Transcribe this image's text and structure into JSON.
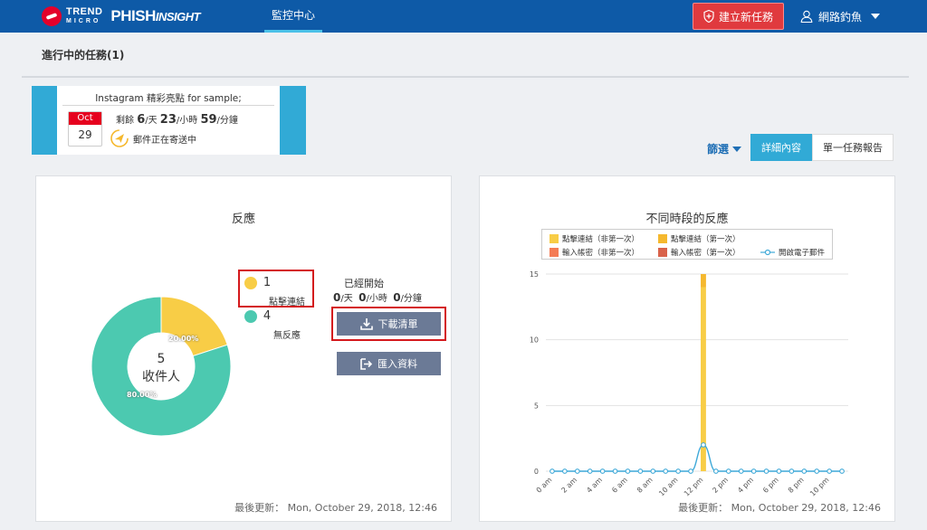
{
  "header": {
    "logo_trend": "TREND",
    "logo_micro": "MICRO",
    "logo_phish": "PHISH",
    "logo_insight": "INSIGHT",
    "nav_tab": "監控中心",
    "new_task_label": "建立新任務",
    "user_name": "網路釣魚",
    "colors": {
      "bar": "#0e5aa7",
      "accent": "#e03a3e"
    }
  },
  "section": {
    "title": "進行中的任務(1)"
  },
  "task": {
    "name": "Instagram 精彩亮點 for sample;",
    "month": "Oct",
    "day": "29",
    "remain_prefix": "剩餘",
    "days": "6",
    "days_unit": "/天",
    "hours": "23",
    "hours_unit": "/小時",
    "minutes": "59",
    "minutes_unit": "/分鐘",
    "status": "郵件正在寄送中"
  },
  "toolbar": {
    "filter_label": "篩選",
    "details_label": "詳細內容",
    "report_label": "單一任務報告"
  },
  "reaction_panel": {
    "title": "反應",
    "center_count": "5",
    "center_label": "收件人",
    "click_count": "1",
    "click_label": "點擊連結",
    "click_color": "#f8cd46",
    "no_response_count": "4",
    "no_response_label": "無反應",
    "no_response_color": "#4cc9b0",
    "click_pct": "20.00%",
    "no_response_pct": "80.00%",
    "started_label": "已經開始",
    "elapsed_days": "0",
    "elapsed_days_unit": "/天",
    "elapsed_hours": "0",
    "elapsed_hours_unit": "/小時",
    "elapsed_minutes": "0",
    "elapsed_minutes_unit": "/分鐘",
    "download_label": "下載清單",
    "import_label": "匯入資料",
    "updated": "最後更新： Mon, October 29, 2018, 12:46"
  },
  "time_panel": {
    "title": "不同時段的反應",
    "updated": "最後更新： Mon, October 29, 2018, 12:46"
  },
  "chart_data": {
    "type": "bar",
    "title": "不同時段的反應",
    "xlabel": "",
    "ylabel": "",
    "ylim": [
      0,
      15
    ],
    "yticks": [
      0,
      5,
      10,
      15
    ],
    "categories": [
      "0 am",
      "1 am",
      "2 am",
      "3 am",
      "4 am",
      "5 am",
      "6 am",
      "7 am",
      "8 am",
      "9 am",
      "10 am",
      "11 am",
      "12 pm",
      "1 pm",
      "2 pm",
      "3 pm",
      "4 pm",
      "5 pm",
      "6 pm",
      "7 pm",
      "8 pm",
      "9 pm",
      "10 pm",
      "11 pm"
    ],
    "xtick_labels": [
      "0 am",
      "2 am",
      "4 am",
      "6 am",
      "8 am",
      "10 am",
      "12 pm",
      "2 pm",
      "4 pm",
      "6 pm",
      "8 pm",
      "10 pm"
    ],
    "legend": "top",
    "grid": true,
    "series": [
      {
        "name": "點擊連結（非第一次）",
        "type": "bar",
        "color": "#f8cd46",
        "values": [
          0,
          0,
          0,
          0,
          0,
          0,
          0,
          0,
          0,
          0,
          0,
          0,
          14,
          0,
          0,
          0,
          0,
          0,
          0,
          0,
          0,
          0,
          0,
          0
        ]
      },
      {
        "name": "點擊連結（第一次）",
        "type": "bar",
        "color": "#f5b82e",
        "values": [
          0,
          0,
          0,
          0,
          0,
          0,
          0,
          0,
          0,
          0,
          0,
          0,
          1,
          0,
          0,
          0,
          0,
          0,
          0,
          0,
          0,
          0,
          0,
          0
        ]
      },
      {
        "name": "輸入帳密（非第一次）",
        "type": "bar",
        "color": "#f47c55",
        "values": [
          0,
          0,
          0,
          0,
          0,
          0,
          0,
          0,
          0,
          0,
          0,
          0,
          0,
          0,
          0,
          0,
          0,
          0,
          0,
          0,
          0,
          0,
          0,
          0
        ]
      },
      {
        "name": "輸入帳密（第一次）",
        "type": "bar",
        "color": "#d9624a",
        "values": [
          0,
          0,
          0,
          0,
          0,
          0,
          0,
          0,
          0,
          0,
          0,
          0,
          0,
          0,
          0,
          0,
          0,
          0,
          0,
          0,
          0,
          0,
          0,
          0
        ]
      },
      {
        "name": "開啟電子郵件",
        "type": "line",
        "color": "#3fa9d8",
        "values": [
          0,
          0,
          0,
          0,
          0,
          0,
          0,
          0,
          0,
          0,
          0,
          0,
          2,
          0,
          0,
          0,
          0,
          0,
          0,
          0,
          0,
          0,
          0,
          0
        ]
      }
    ]
  },
  "donut_data": {
    "type": "pie",
    "total": 5,
    "slices": [
      {
        "label": "點擊連結",
        "value": 1,
        "color": "#f8cd46"
      },
      {
        "label": "無反應",
        "value": 4,
        "color": "#4cc9b0"
      }
    ]
  }
}
